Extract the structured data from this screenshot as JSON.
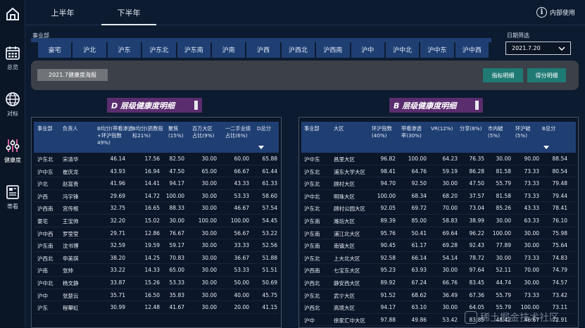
{
  "topbar": {
    "tabs": [
      {
        "label": "上半年",
        "active": false
      },
      {
        "label": "下半年",
        "active": true
      }
    ],
    "internal_label": "内部使用"
  },
  "sidebar": {
    "items": [
      {
        "label": "总览",
        "icon": "calendar-icon"
      },
      {
        "label": "对标",
        "icon": "globe-icon"
      },
      {
        "label": "健康度",
        "icon": "sliders-icon",
        "active": true
      },
      {
        "label": "帯看",
        "icon": "document-icon"
      }
    ]
  },
  "filters": {
    "dept_label": "事业部",
    "departments": [
      "豪宅",
      "沪北",
      "沪东",
      "沪东北",
      "沪东南",
      "沪南",
      "沪西",
      "沪西北",
      "沪西南",
      "沪中",
      "沪中北",
      "沪中东",
      "沪中西"
    ],
    "date_label": "日期筛选",
    "date_value": "2021.7.20"
  },
  "actions": {
    "report": "2021.7健康度海报",
    "indicator_detail": "指标明细",
    "score_detail": "得分明细"
  },
  "d_table": {
    "title": "D 层级健康度明细",
    "headers": [
      "事业部",
      "负责人",
      "B均分(带看渗透\n+环沪指数\n49%)",
      "B均分(抓数指\n标21%)",
      "聚焦\n(15%)",
      "百万大区\n占比(9%)",
      "一二手业绩\n占比(6%)",
      "D总分"
    ],
    "rows": [
      [
        "沪东北",
        "宋清华",
        "46.14",
        "17.56",
        "82.50",
        "30.00",
        "60.00",
        "65.88"
      ],
      [
        "沪中东",
        "崔庆龙",
        "43.93",
        "16.94",
        "47.50",
        "65.00",
        "66.67",
        "61.44"
      ],
      [
        "沪北",
        "赵富贵",
        "41.96",
        "14.41",
        "94.17",
        "30.00",
        "43.33",
        "61.33"
      ],
      [
        "沪西",
        "冯宇锋",
        "29.69",
        "14.72",
        "100.00",
        "30.00",
        "53.33",
        "58.60"
      ],
      [
        "沪西南",
        "宫传根",
        "32.75",
        "16.65",
        "88.33",
        "30.00",
        "46.67",
        "57.54"
      ],
      [
        "豪宅",
        "王宝帅",
        "32.20",
        "15.02",
        "30.00",
        "100.00",
        "100.00",
        "54.45"
      ],
      [
        "沪中西",
        "罗莹莹",
        "29.71",
        "12.86",
        "76.67",
        "30.00",
        "56.67",
        "53.22"
      ],
      [
        "沪东南",
        "沈书博",
        "32.59",
        "19.59",
        "59.17",
        "30.00",
        "33.33",
        "52.56"
      ],
      [
        "沪西北",
        "申美琪",
        "38.20",
        "14.25",
        "70.83",
        "30.00",
        "36.67",
        "51.88"
      ],
      [
        "沪南",
        "张帅",
        "33.22",
        "14.33",
        "65.00",
        "30.00",
        "53.33",
        "51.51"
      ],
      [
        "沪中北",
        "杨文静",
        "33.87",
        "15.26",
        "53.33",
        "30.00",
        "50.00",
        "50.69"
      ],
      [
        "沪中",
        "张楚云",
        "35.71",
        "16.50",
        "35.83",
        "30.00",
        "40.00",
        "45.75"
      ],
      [
        "沪东",
        "程攀虹",
        "30.99",
        "12.48",
        "41.67",
        "30.00",
        "20.00",
        "41.15"
      ]
    ]
  },
  "b_table": {
    "title": "B 层级健康度明细",
    "headers": [
      "事业部",
      "大区",
      "环沪指数\n(40%)",
      "带看渗透\n率(30%)",
      "VR(12%)",
      "分享(8%)",
      "市内破\n(5%)",
      "环沪破\n(5%)",
      "B总分"
    ],
    "rows": [
      [
        "沪中东",
        "昌里大区",
        "96.82",
        "100.00",
        "64.23",
        "76.35",
        "30.00",
        "90.00",
        "88.54"
      ],
      [
        "沪东北",
        "浦东大学大区",
        "98.41",
        "64.76",
        "59.19",
        "86.28",
        "81.58",
        "73.33",
        "80.54"
      ],
      [
        "沪东北",
        "顾村大区",
        "94.70",
        "92.50",
        "30.00",
        "47.50",
        "55.79",
        "73.33",
        "79.48"
      ],
      [
        "沪中北",
        "明珠大区",
        "100.00",
        "68.34",
        "68.20",
        "37.57",
        "81.58",
        "73.33",
        "79.44"
      ],
      [
        "沪东北",
        "顾村公园大区",
        "92.05",
        "69.72",
        "70.00",
        "73.04",
        "85.26",
        "43.33",
        "78.41"
      ],
      [
        "沪东南",
        "潍坊大区",
        "89.39",
        "85.00",
        "58.83",
        "38.99",
        "30.00",
        "63.33",
        "76.10"
      ],
      [
        "沪东南",
        "浦江北大区",
        "95.76",
        "50.41",
        "69.64",
        "96.22",
        "100.00",
        "30.00",
        "75.98"
      ],
      [
        "沪东南",
        "南镇大区",
        "90.45",
        "61.17",
        "69.28",
        "92.43",
        "77.89",
        "30.00",
        "75.64"
      ],
      [
        "沪东北",
        "上大北大区",
        "92.58",
        "66.14",
        "54.14",
        "78.72",
        "30.00",
        "73.33",
        "74.83"
      ],
      [
        "沪西南",
        "七宝东大区",
        "95.23",
        "63.93",
        "30.00",
        "97.64",
        "52.11",
        "70.00",
        "74.79"
      ],
      [
        "沪西北",
        "静安西大区",
        "89.92",
        "67.24",
        "66.76",
        "83.45",
        "44.74",
        "30.00",
        "74.57"
      ],
      [
        "沪东北",
        "武宁大区",
        "91.52",
        "68.62",
        "36.49",
        "67.36",
        "55.79",
        "73.33",
        "73.42"
      ],
      [
        "沪西北",
        "高境大区",
        "94.17",
        "63.10",
        "30.00",
        "64.05",
        "55.79",
        "100.00",
        "73.11"
      ],
      [
        "沪中",
        "徐家汇中大区",
        "97.88",
        "49.86",
        "53.42",
        "83.85",
        "48.42",
        "46.67",
        "72.91"
      ]
    ]
  },
  "watermark": "稀土掘金技术社区"
}
